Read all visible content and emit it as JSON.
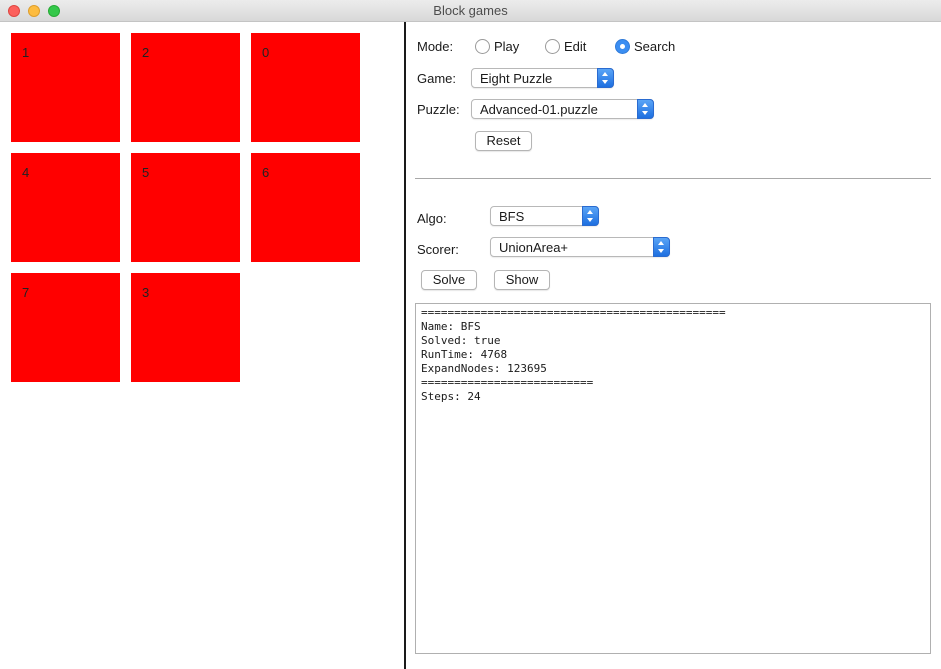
{
  "window": {
    "title": "Block games"
  },
  "board": {
    "tiles": [
      "1",
      "2",
      "0",
      "4",
      "5",
      "6",
      "7",
      "3"
    ],
    "tile_color": "#ff0000"
  },
  "mode": {
    "label": "Mode:",
    "options": [
      "Play",
      "Edit",
      "Search"
    ],
    "selected": "Search"
  },
  "game": {
    "label": "Game:",
    "value": "Eight Puzzle"
  },
  "puzzle": {
    "label": "Puzzle:",
    "value": "Advanced-01.puzzle"
  },
  "reset_label": "Reset",
  "algo": {
    "label": "Algo:",
    "value": "BFS"
  },
  "scorer": {
    "label": "Scorer:",
    "value": "UnionArea+"
  },
  "solve_label": "Solve",
  "show_label": "Show",
  "output": {
    "lines": [
      "==============================================",
      "Name: BFS",
      "Solved: true",
      "RunTime: 4768",
      "ExpandNodes: 123695",
      "==========================",
      "Steps: 24"
    ]
  },
  "colors": {
    "accent": "#3b8ef2",
    "close": "#fc605c",
    "minimize": "#fdbc40",
    "maximize": "#34c84a"
  }
}
